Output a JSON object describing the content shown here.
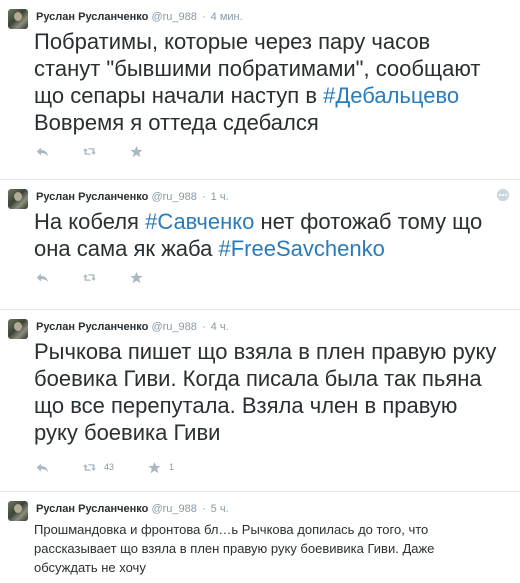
{
  "tweets": [
    {
      "fullname": "Руслан Русланченко",
      "username": "@ru_988",
      "sep": "·",
      "time": "4 мин.",
      "text_a": "Побратимы, которые через пару часов станут \"бывшими побратимами\", сообщают що сепары начали наступ в ",
      "hashtag1": "#Дебальцево",
      "text_b": " Вовремя я оттеда сдебался",
      "retweet_count": "",
      "favorite_count": ""
    },
    {
      "fullname": "Руслан Русланченко",
      "username": "@ru_988",
      "sep": "·",
      "time": "1 ч.",
      "text_a": "На  кобеля ",
      "hashtag1": "#Савченко",
      "text_b": " нет фотожаб тому що она сама як жаба ",
      "hashtag2": "#FreeSavchenko",
      "retweet_count": "",
      "favorite_count": ""
    },
    {
      "fullname": "Руслан Русланченко",
      "username": "@ru_988",
      "sep": "·",
      "time": "4 ч.",
      "text_a": "Рычкова пишет що взяла в плен правую руку боевика Гиви. Когда писала была так пьяна що все перепутала. Взяла член в правую руку боевика Гиви",
      "retweet_count": "43",
      "favorite_count": "1"
    },
    {
      "fullname": "Руслан Русланченко",
      "username": "@ru_988",
      "sep": "·",
      "time": "5 ч.",
      "text_a": "Прошмандовка и фронтова бл…ь Рычкова допилась до того, что рассказывает що взяла в плен правую руку боевивика Гиви. Даже обсуждать не хочу"
    }
  ],
  "icons": {
    "reply": "reply-icon",
    "retweet": "retweet-icon",
    "favorite": "star-icon",
    "more": "more-icon"
  },
  "colors": {
    "hashtag": "#2b7bb9",
    "meta": "#8899a6",
    "icon": "#aab8c2",
    "divider": "#e1e8ed"
  }
}
